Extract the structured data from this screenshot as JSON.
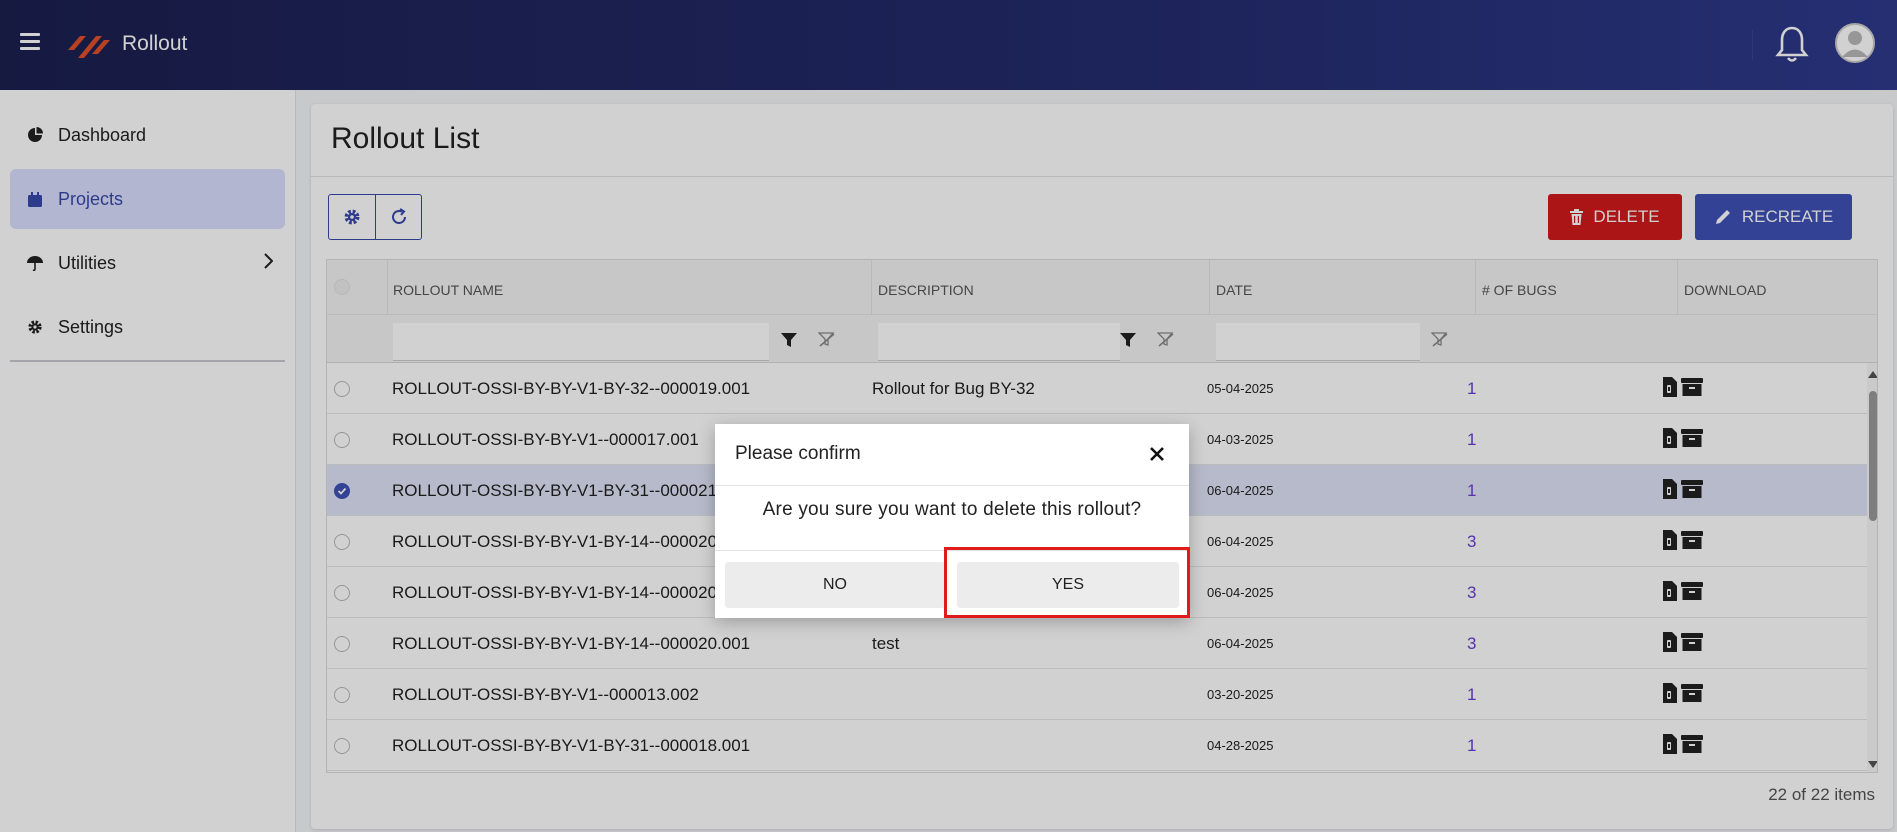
{
  "app": {
    "title": "Rollout"
  },
  "sidebar": {
    "items": [
      {
        "label": "Dashboard",
        "icon": "pie-chart-icon"
      },
      {
        "label": "Projects",
        "icon": "calendar-icon"
      },
      {
        "label": "Utilities",
        "icon": "umbrella-icon"
      },
      {
        "label": "Settings",
        "icon": "gear-icon"
      }
    ]
  },
  "main": {
    "title": "Rollout List",
    "delete_label": "DELETE",
    "recreate_label": "RECREATE",
    "columns": [
      "ROLLOUT NAME",
      "DESCRIPTION",
      "DATE",
      "# OF BUGS",
      "DOWNLOAD"
    ],
    "rows": [
      {
        "name": "ROLLOUT-OSSI-BY-BY-V1-BY-32--000019.001",
        "description": "Rollout for Bug BY-32",
        "date": "05-04-2025",
        "bugs": "1",
        "selected": false
      },
      {
        "name": "ROLLOUT-OSSI-BY-BY-V1--000017.001",
        "description": "",
        "date": "04-03-2025",
        "bugs": "1",
        "selected": false
      },
      {
        "name": "ROLLOUT-OSSI-BY-BY-V1-BY-31--000021.0",
        "description": "",
        "date": "06-04-2025",
        "bugs": "1",
        "selected": true
      },
      {
        "name": "ROLLOUT-OSSI-BY-BY-V1-BY-14--000020.0",
        "description": "",
        "date": "06-04-2025",
        "bugs": "3",
        "selected": false
      },
      {
        "name": "ROLLOUT-OSSI-BY-BY-V1-BY-14--000020.0",
        "description": "",
        "date": "06-04-2025",
        "bugs": "3",
        "selected": false
      },
      {
        "name": "ROLLOUT-OSSI-BY-BY-V1-BY-14--000020.001",
        "description": "test",
        "date": "06-04-2025",
        "bugs": "3",
        "selected": false
      },
      {
        "name": "ROLLOUT-OSSI-BY-BY-V1--000013.002",
        "description": "",
        "date": "03-20-2025",
        "bugs": "1",
        "selected": false
      },
      {
        "name": "ROLLOUT-OSSI-BY-BY-V1-BY-31--000018.001",
        "description": "",
        "date": "04-28-2025",
        "bugs": "1",
        "selected": false
      }
    ],
    "items_count": "22 of 22 items"
  },
  "dialog": {
    "title": "Please confirm",
    "message": "Are you sure you want to delete this rollout?",
    "no_label": "NO",
    "yes_label": "YES"
  },
  "colors": {
    "header_start": "#1c2050",
    "header_end": "#2e3a8c",
    "accent": "#3f51b5",
    "danger": "#d11a1a",
    "bug_link": "#6a3fd2",
    "highlight": "#e01b1b",
    "logo": "#e0502a"
  }
}
